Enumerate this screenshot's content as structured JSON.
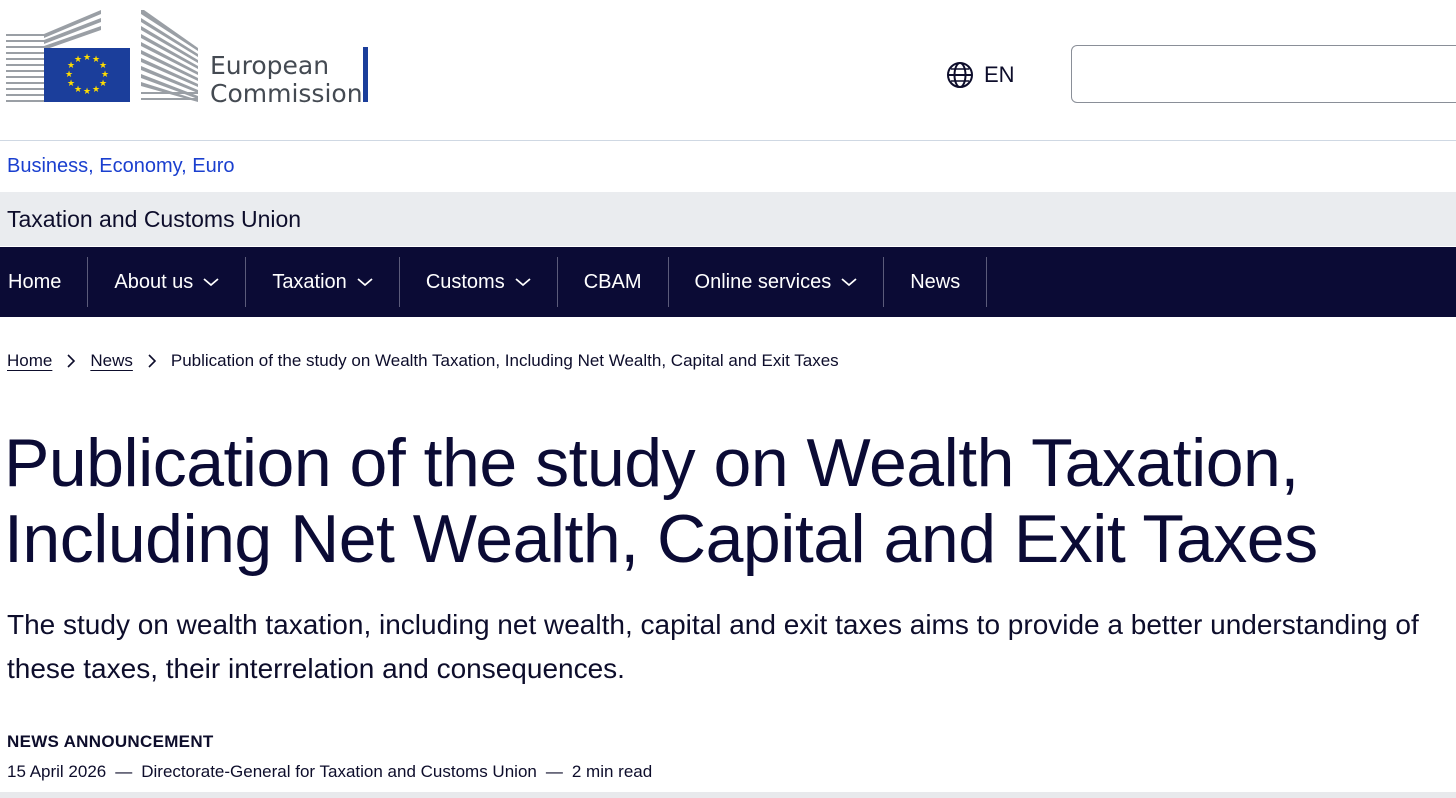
{
  "header": {
    "logo_line1": "European",
    "logo_line2": "Commission",
    "language_code": "EN",
    "search_placeholder": ""
  },
  "site": {
    "parent_link": "Business, Economy, Euro",
    "title": "Taxation and Customs Union"
  },
  "nav": {
    "items": [
      {
        "label": "Home",
        "has_dropdown": false
      },
      {
        "label": "About us",
        "has_dropdown": true
      },
      {
        "label": "Taxation",
        "has_dropdown": true
      },
      {
        "label": "Customs",
        "has_dropdown": true
      },
      {
        "label": "CBAM",
        "has_dropdown": false
      },
      {
        "label": "Online services",
        "has_dropdown": true
      },
      {
        "label": "News",
        "has_dropdown": false
      }
    ]
  },
  "breadcrumb": {
    "home": "Home",
    "news": "News",
    "current": "Publication of the study on Wealth Taxation, Including Net Wealth, Capital and Exit Taxes"
  },
  "article": {
    "title": "Publication of the study on Wealth Taxation, Including Net Wealth, Capital and Exit Taxes",
    "lead": "The study on wealth taxation, including net wealth, capital and exit taxes aims to provide a better understanding of these taxes, their interrelation and consequences.",
    "type": "NEWS ANNOUNCEMENT",
    "date": "15 April 2026",
    "author": "Directorate-General for Taxation and Customs Union",
    "read_time": "2 min read",
    "separator": "—"
  },
  "colors": {
    "nav_bg": "#0b0b35",
    "link": "#1a3fcf",
    "eu_blue": "#1b3e9b",
    "eu_star": "#ffdd00"
  }
}
